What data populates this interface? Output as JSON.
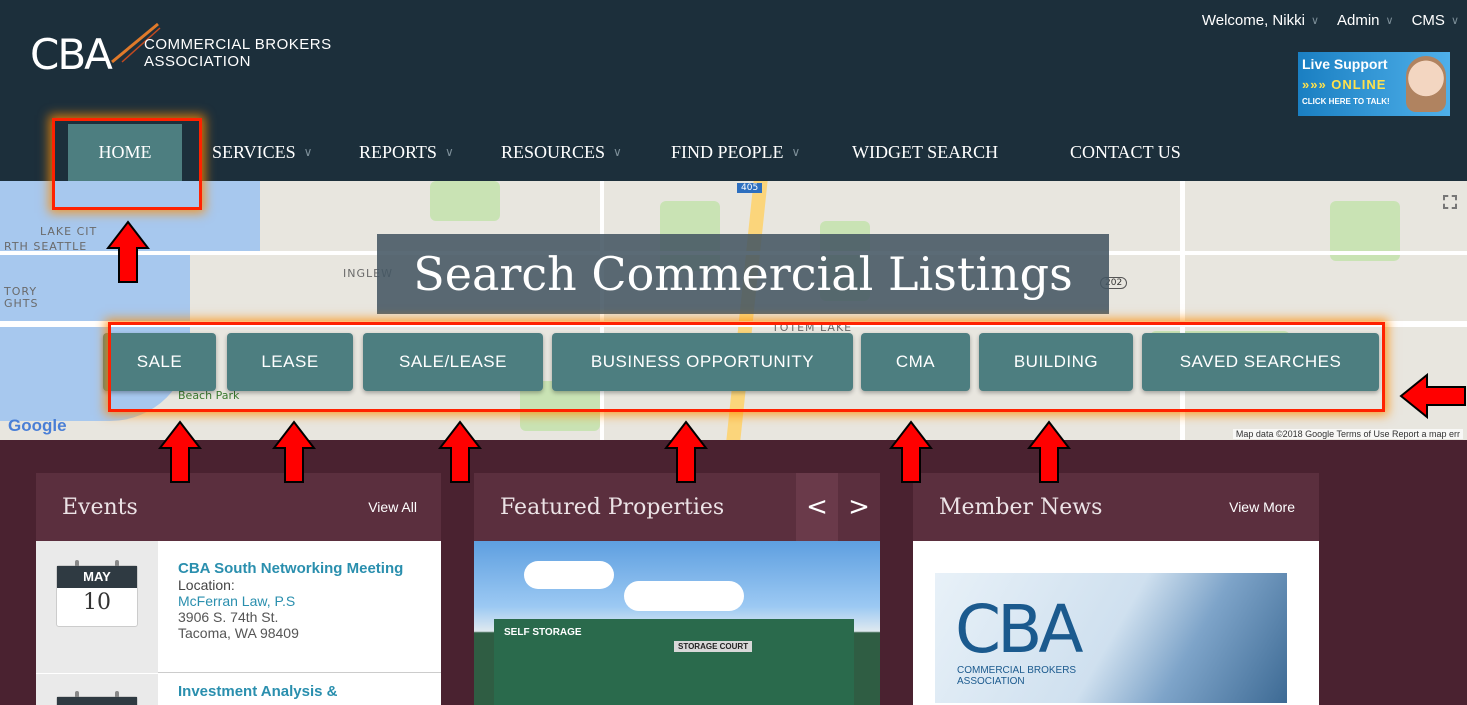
{
  "brand": {
    "mark": "CBA",
    "name_line1": "COMMERCIAL BROKERS",
    "name_line2": "ASSOCIATION"
  },
  "topbar": {
    "welcome": "Welcome, Nikki",
    "admin": "Admin",
    "cms": "CMS"
  },
  "live_support": {
    "line1": "Live Support",
    "line2": "»»» ONLINE",
    "line3": "CLICK HERE TO TALK!"
  },
  "nav": {
    "items": [
      {
        "label": "HOME"
      },
      {
        "label": "SERVICES"
      },
      {
        "label": "REPORTS"
      },
      {
        "label": "RESOURCES"
      },
      {
        "label": "FIND PEOPLE"
      },
      {
        "label": "WIDGET SEARCH"
      },
      {
        "label": "CONTACT US"
      }
    ]
  },
  "map": {
    "labels": [
      "LAKE CIT",
      "RTH SEATTLE",
      "INGLEW",
      "TOTEM LAKE",
      "TORY",
      "GHTS",
      "Beach Park"
    ],
    "route": "405",
    "route2": "202",
    "google": "Google",
    "credit": "Map data ©2018 Google   Terms of Use   Report a map err"
  },
  "hero": {
    "title": "Search Commercial Listings"
  },
  "categories": [
    "SALE",
    "LEASE",
    "SALE/LEASE",
    "BUSINESS OPPORTUNITY",
    "CMA",
    "BUILDING",
    "SAVED SEARCHES"
  ],
  "events": {
    "title": "Events",
    "link": "View All",
    "items": [
      {
        "month": "MAY",
        "day": "10",
        "name": "CBA South Networking Meeting",
        "location_label": "Location:",
        "venue": "McFerran Law, P.S",
        "address1": "3906 S. 74th St.",
        "address2": "Tacoma, WA 98409"
      },
      {
        "name": "Investment Analysis &"
      }
    ]
  },
  "featured": {
    "title": "Featured Properties",
    "prev": "<",
    "next": ">",
    "sign1": "SELF STORAGE",
    "sign2": "STORAGE COURT"
  },
  "news": {
    "title": "Member News",
    "link": "View More",
    "logo_mark": "CBA",
    "logo_text1": "COMMERCIAL BROKERS",
    "logo_text2": "ASSOCIATION"
  },
  "colors": {
    "header": "#1c2f3b",
    "accent_teal": "#4d7e80",
    "body": "#4a2230",
    "card": "#5b2f3e",
    "annotation_red": "#ff2200"
  }
}
